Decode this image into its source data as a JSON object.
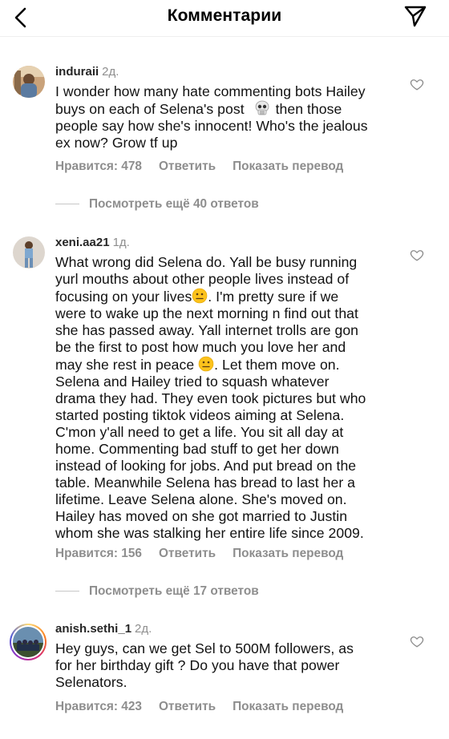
{
  "header": {
    "title": "Комментарии",
    "back_icon": "chevron-left-icon",
    "send_icon": "paper-plane-icon"
  },
  "comments": [
    {
      "username": "induraii",
      "time": "2д.",
      "text_lines": [
        "I wonder how many hate commenting bots Hailey",
        "buys on each of Selena's post",
        "then those",
        "people say how she's innocent! Who's the jealous",
        "ex now? Grow tf up"
      ],
      "emoji": "skull-emoji",
      "likes_label": "Нравится: 478",
      "reply_label": "Ответить",
      "translate_label": "Показать перевод",
      "more_replies": "Посмотреть ещё 40 ответов"
    },
    {
      "username": "xeni.aa21",
      "time": "1д.",
      "text_lines": [
        "What wrong did Selena do. Yall be busy running",
        "yurl mouths about other people lives instead of",
        "focusing on your lives",
        ". I'm pretty sure if we",
        "were to wake up the next morning n find out that",
        "she has passed away. Yall internet trolls are gon",
        "be the first to post how much you love her and",
        "may she rest in peace",
        ". Let them move on.",
        "Selena and Hailey tried to squash whatever",
        "drama they had. They even took pictures but who",
        "started posting tiktok videos aiming at Selena.",
        "C'mon y'all need to get a life. You sit all day at",
        "home. Commenting bad stuff to get her down",
        "instead of looking for jobs. And put bread on the",
        "table. Meanwhile Selena has bread to last her a",
        "lifetime. Leave Selena alone. She's moved on.",
        "Hailey has moved on she got married to Justin",
        "whom she was stalking her entire life since 2009."
      ],
      "emoji": "neutral-face-emoji",
      "likes_label": "Нравится: 156",
      "reply_label": "Ответить",
      "translate_label": "Показать перевод",
      "more_replies": "Посмотреть ещё 17 ответов"
    },
    {
      "username": "anish.sethi_1",
      "time": "2д.",
      "text_lines": [
        "Hey guys, can we get Sel to 500M followers, as",
        "for her birthday gift ? Do you have that power",
        "Selenators."
      ],
      "likes_label": "Нравится: 423",
      "reply_label": "Ответить",
      "translate_label": "Показать перевод"
    }
  ]
}
